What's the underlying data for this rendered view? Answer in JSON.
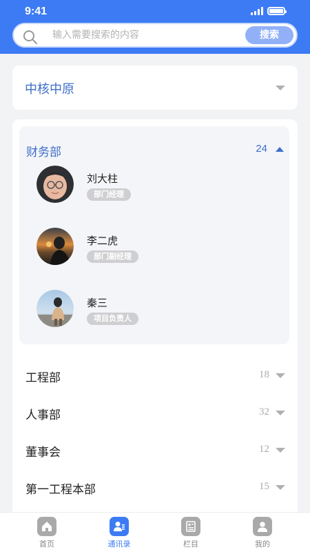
{
  "status_bar": {
    "time": "9:41"
  },
  "search": {
    "placeholder": "输入需要搜索的内容",
    "value": "",
    "button_label": "搜索"
  },
  "organization": {
    "name": "中核中原"
  },
  "expanded_department": {
    "name": "财务部",
    "count": "24",
    "members": [
      {
        "name": "刘大柱",
        "role": "部门经理"
      },
      {
        "name": "李二虎",
        "role": "部门副经理"
      },
      {
        "name": "秦三",
        "role": "项目负责人"
      }
    ]
  },
  "departments": [
    {
      "name": "工程部",
      "count": "18"
    },
    {
      "name": "人事部",
      "count": "32"
    },
    {
      "name": "董事会",
      "count": "12"
    },
    {
      "name": "第一工程本部",
      "count": "15"
    }
  ],
  "bottom_nav": [
    {
      "label": "首页",
      "icon": "home-icon",
      "active": false
    },
    {
      "label": "通讯录",
      "icon": "contacts-icon",
      "active": true
    },
    {
      "label": "栏目",
      "icon": "column-icon",
      "active": false
    },
    {
      "label": "我的",
      "icon": "profile-icon",
      "active": false
    }
  ],
  "colors": {
    "accent": "#3d7bf5",
    "link_text": "#3d6ec9",
    "badge": "#cfcfd2",
    "inactive_icon": "#a9a9a9"
  }
}
